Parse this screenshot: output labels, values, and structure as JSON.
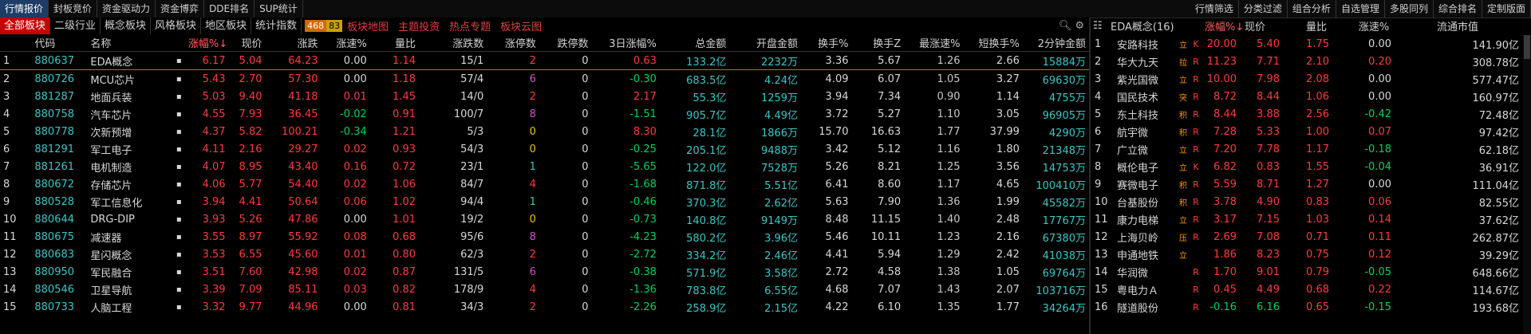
{
  "topbar": {
    "left": [
      "行情报价",
      "封板竞价",
      "资金驱动力",
      "资金博弈",
      "DDE排名",
      "SUP统计"
    ],
    "right": [
      "行情筛选",
      "分类过滤",
      "组合分析",
      "自选管理",
      "多股同列",
      "综合排名",
      "定制版面"
    ]
  },
  "tabs": {
    "items": [
      "全部板块",
      "二级行业",
      "概念板块",
      "风格板块",
      "地区板块",
      "统计指数"
    ],
    "count_up": "468",
    "count_down": "83",
    "links": [
      "板块地图",
      "主题投资",
      "热点专题",
      "板块云图"
    ]
  },
  "main": {
    "headers": [
      "",
      "代码",
      "名称",
      "",
      "涨幅%↓",
      "现价",
      "涨跌",
      "涨速%",
      "量比",
      "涨跌数",
      "涨停数",
      "跌停数",
      "3日涨幅%",
      "总金额",
      "开盘金额",
      "换手%",
      "换手Z",
      "最涨速%",
      "短换手%",
      "2分钟金额"
    ],
    "rows": [
      [
        "1",
        "880637",
        "EDA概念",
        "6.17",
        "5.04",
        "64.23",
        "0.00",
        "1.14",
        "15/1",
        "2",
        "0",
        "0.63",
        "133.2亿",
        "2232万",
        "3.36",
        "5.67",
        "1.26",
        "2.66",
        "15884万"
      ],
      [
        "2",
        "880726",
        "MCU芯片",
        "5.43",
        "2.70",
        "57.30",
        "0.00",
        "1.18",
        "57/4",
        "6",
        "0",
        "-0.30",
        "683.5亿",
        "4.24亿",
        "4.09",
        "6.07",
        "1.05",
        "3.27",
        "69630万"
      ],
      [
        "3",
        "881287",
        "地面兵装",
        "5.03",
        "9.40",
        "41.18",
        "0.01",
        "1.45",
        "14/0",
        "2",
        "0",
        "2.17",
        "55.3亿",
        "1259万",
        "3.94",
        "7.34",
        "0.90",
        "1.14",
        "4755万"
      ],
      [
        "4",
        "880758",
        "汽车芯片",
        "4.55",
        "7.93",
        "36.45",
        "-0.02",
        "0.91",
        "100/7",
        "8",
        "0",
        "-1.51",
        "905.7亿",
        "4.49亿",
        "3.72",
        "5.27",
        "1.10",
        "3.05",
        "96905万"
      ],
      [
        "5",
        "880778",
        "次新预增",
        "4.37",
        "5.82",
        "100.21",
        "-0.34",
        "1.21",
        "5/3",
        "0",
        "0",
        "8.30",
        "28.1亿",
        "1866万",
        "15.70",
        "16.63",
        "1.77",
        "37.99",
        "4290万"
      ],
      [
        "6",
        "881291",
        "军工电子",
        "4.11",
        "2.16",
        "29.27",
        "0.02",
        "0.93",
        "54/3",
        "0",
        "0",
        "-0.25",
        "205.1亿",
        "9488万",
        "3.42",
        "5.12",
        "1.16",
        "1.80",
        "21348万"
      ],
      [
        "7",
        "881261",
        "电机制造",
        "4.07",
        "8.95",
        "43.40",
        "0.16",
        "0.72",
        "23/1",
        "1",
        "0",
        "-5.65",
        "122.0亿",
        "7528万",
        "5.26",
        "8.21",
        "1.25",
        "3.56",
        "14753万"
      ],
      [
        "8",
        "880672",
        "存储芯片",
        "4.06",
        "5.77",
        "54.40",
        "0.02",
        "1.06",
        "84/7",
        "4",
        "0",
        "-1.68",
        "871.8亿",
        "5.51亿",
        "6.41",
        "8.60",
        "1.17",
        "4.65",
        "100410万"
      ],
      [
        "9",
        "880528",
        "军工信息化",
        "3.94",
        "4.41",
        "50.64",
        "0.06",
        "1.02",
        "94/4",
        "1",
        "0",
        "-0.46",
        "370.3亿",
        "2.62亿",
        "5.63",
        "7.90",
        "1.36",
        "1.99",
        "45582万"
      ],
      [
        "10",
        "880644",
        "DRG-DIP",
        "3.93",
        "5.26",
        "47.86",
        "0.00",
        "1.01",
        "19/2",
        "0",
        "0",
        "-0.73",
        "140.8亿",
        "9149万",
        "8.48",
        "11.15",
        "1.40",
        "2.48",
        "17767万"
      ],
      [
        "11",
        "880675",
        "减速器",
        "3.55",
        "8.97",
        "55.92",
        "0.08",
        "0.68",
        "95/6",
        "8",
        "0",
        "-4.23",
        "580.2亿",
        "3.96亿",
        "5.46",
        "10.11",
        "1.23",
        "2.16",
        "67380万"
      ],
      [
        "12",
        "880683",
        "星闪概念",
        "3.53",
        "6.55",
        "45.60",
        "0.01",
        "0.80",
        "62/3",
        "2",
        "0",
        "-2.72",
        "334.2亿",
        "2.46亿",
        "4.41",
        "5.94",
        "1.29",
        "2.42",
        "41038万"
      ],
      [
        "13",
        "880950",
        "军民融合",
        "3.51",
        "7.60",
        "42.98",
        "0.02",
        "0.87",
        "131/5",
        "6",
        "0",
        "-0.38",
        "571.9亿",
        "3.58亿",
        "2.72",
        "4.58",
        "1.38",
        "1.05",
        "69764万"
      ],
      [
        "14",
        "880546",
        "卫星导航",
        "3.39",
        "7.09",
        "85.11",
        "0.03",
        "0.82",
        "178/9",
        "4",
        "0",
        "-1.36",
        "783.8亿",
        "6.55亿",
        "4.68",
        "7.07",
        "1.43",
        "2.07",
        "103716万"
      ],
      [
        "15",
        "880733",
        "人脑工程",
        "3.32",
        "9.77",
        "44.96",
        "0.00",
        "0.81",
        "34/3",
        "2",
        "0",
        "-2.26",
        "258.9亿",
        "2.15亿",
        "4.22",
        "6.10",
        "1.35",
        "1.77",
        "34264万"
      ]
    ],
    "up_colors": [
      "#ff3b3b",
      "#d050d0",
      "#ff3b3b",
      "#d050d0",
      "#e8c020",
      "#e8c020",
      "#3cc6c6",
      "#ff3b3b",
      "#3cc6c6",
      "#e8c020",
      "#d050d0",
      "#ff3b3b",
      "#d050d0",
      "#ff3b3b",
      "#ff3b3b"
    ]
  },
  "right": {
    "title": "EDA概念(16)",
    "headers": [
      "",
      "名称",
      "",
      "涨幅%↓",
      "现价",
      "量比",
      "涨速%",
      "流通市值"
    ],
    "rows": [
      [
        "1",
        "安路科技",
        "立",
        "K",
        "20.00",
        "5.40",
        "1.75",
        "0.00",
        "141.90亿"
      ],
      [
        "2",
        "华大九天",
        "拉",
        "R",
        "11.23",
        "7.71",
        "2.10",
        "0.20",
        "308.78亿"
      ],
      [
        "3",
        "紫光国微",
        "立",
        "R",
        "10.00",
        "7.98",
        "2.08",
        "0.00",
        "577.47亿"
      ],
      [
        "4",
        "国民技术",
        "突",
        "R",
        "8.72",
        "8.44",
        "1.06",
        "0.00",
        "160.97亿"
      ],
      [
        "5",
        "东土科技",
        "积",
        "R",
        "8.44",
        "3.88",
        "2.56",
        "-0.42",
        "72.48亿"
      ],
      [
        "6",
        "航宇微",
        "积",
        "R",
        "7.28",
        "5.33",
        "1.00",
        "0.07",
        "97.42亿"
      ],
      [
        "7",
        "广立微",
        "立",
        "R",
        "7.20",
        "7.78",
        "1.17",
        "-0.18",
        "62.18亿"
      ],
      [
        "8",
        "概伦电子",
        "立",
        "K",
        "6.82",
        "0.83",
        "1.55",
        "-0.04",
        "36.91亿"
      ],
      [
        "9",
        "赛微电子",
        "积",
        "R",
        "5.59",
        "8.71",
        "1.27",
        "0.00",
        "111.04亿"
      ],
      [
        "10",
        "台基股份",
        "积",
        "R",
        "3.78",
        "4.90",
        "0.83",
        "0.06",
        "82.55亿"
      ],
      [
        "11",
        "康力电梯",
        "立",
        "R",
        "3.17",
        "7.15",
        "1.03",
        "0.14",
        "37.62亿"
      ],
      [
        "12",
        "上海贝岭",
        "压",
        "R",
        "2.69",
        "7.08",
        "0.71",
        "0.11",
        "262.87亿"
      ],
      [
        "13",
        "申通地铁",
        "立",
        "",
        "1.86",
        "8.23",
        "0.75",
        "0.12",
        "39.29亿"
      ],
      [
        "14",
        "华润微",
        "",
        "R",
        "1.70",
        "9.01",
        "0.79",
        "-0.05",
        "648.66亿"
      ],
      [
        "15",
        "粤电力Ａ",
        "",
        "R",
        "0.45",
        "4.49",
        "0.68",
        "0.22",
        "114.67亿"
      ],
      [
        "16",
        "隧道股份",
        "",
        "R",
        "-0.16",
        "6.16",
        "0.65",
        "-0.15",
        "193.68亿"
      ]
    ]
  },
  "colors": {
    "up": "#ff3b3b",
    "down": "#00d060",
    "code": "#3cc6c6",
    "accent": "#c40000"
  }
}
